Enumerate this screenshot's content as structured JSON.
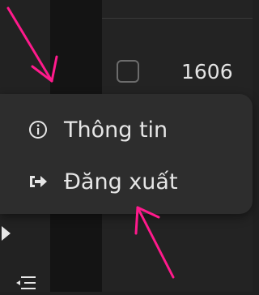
{
  "table": {
    "row_value": "1606"
  },
  "menu": {
    "items": [
      {
        "label": "Thông tin",
        "icon": "info-circle-icon"
      },
      {
        "label": "Đăng xuất",
        "icon": "logout-icon"
      }
    ]
  },
  "colors": {
    "background": "#202020",
    "menu_background": "#2d2d2d",
    "annotation_arrow": "#ff1a8c"
  }
}
